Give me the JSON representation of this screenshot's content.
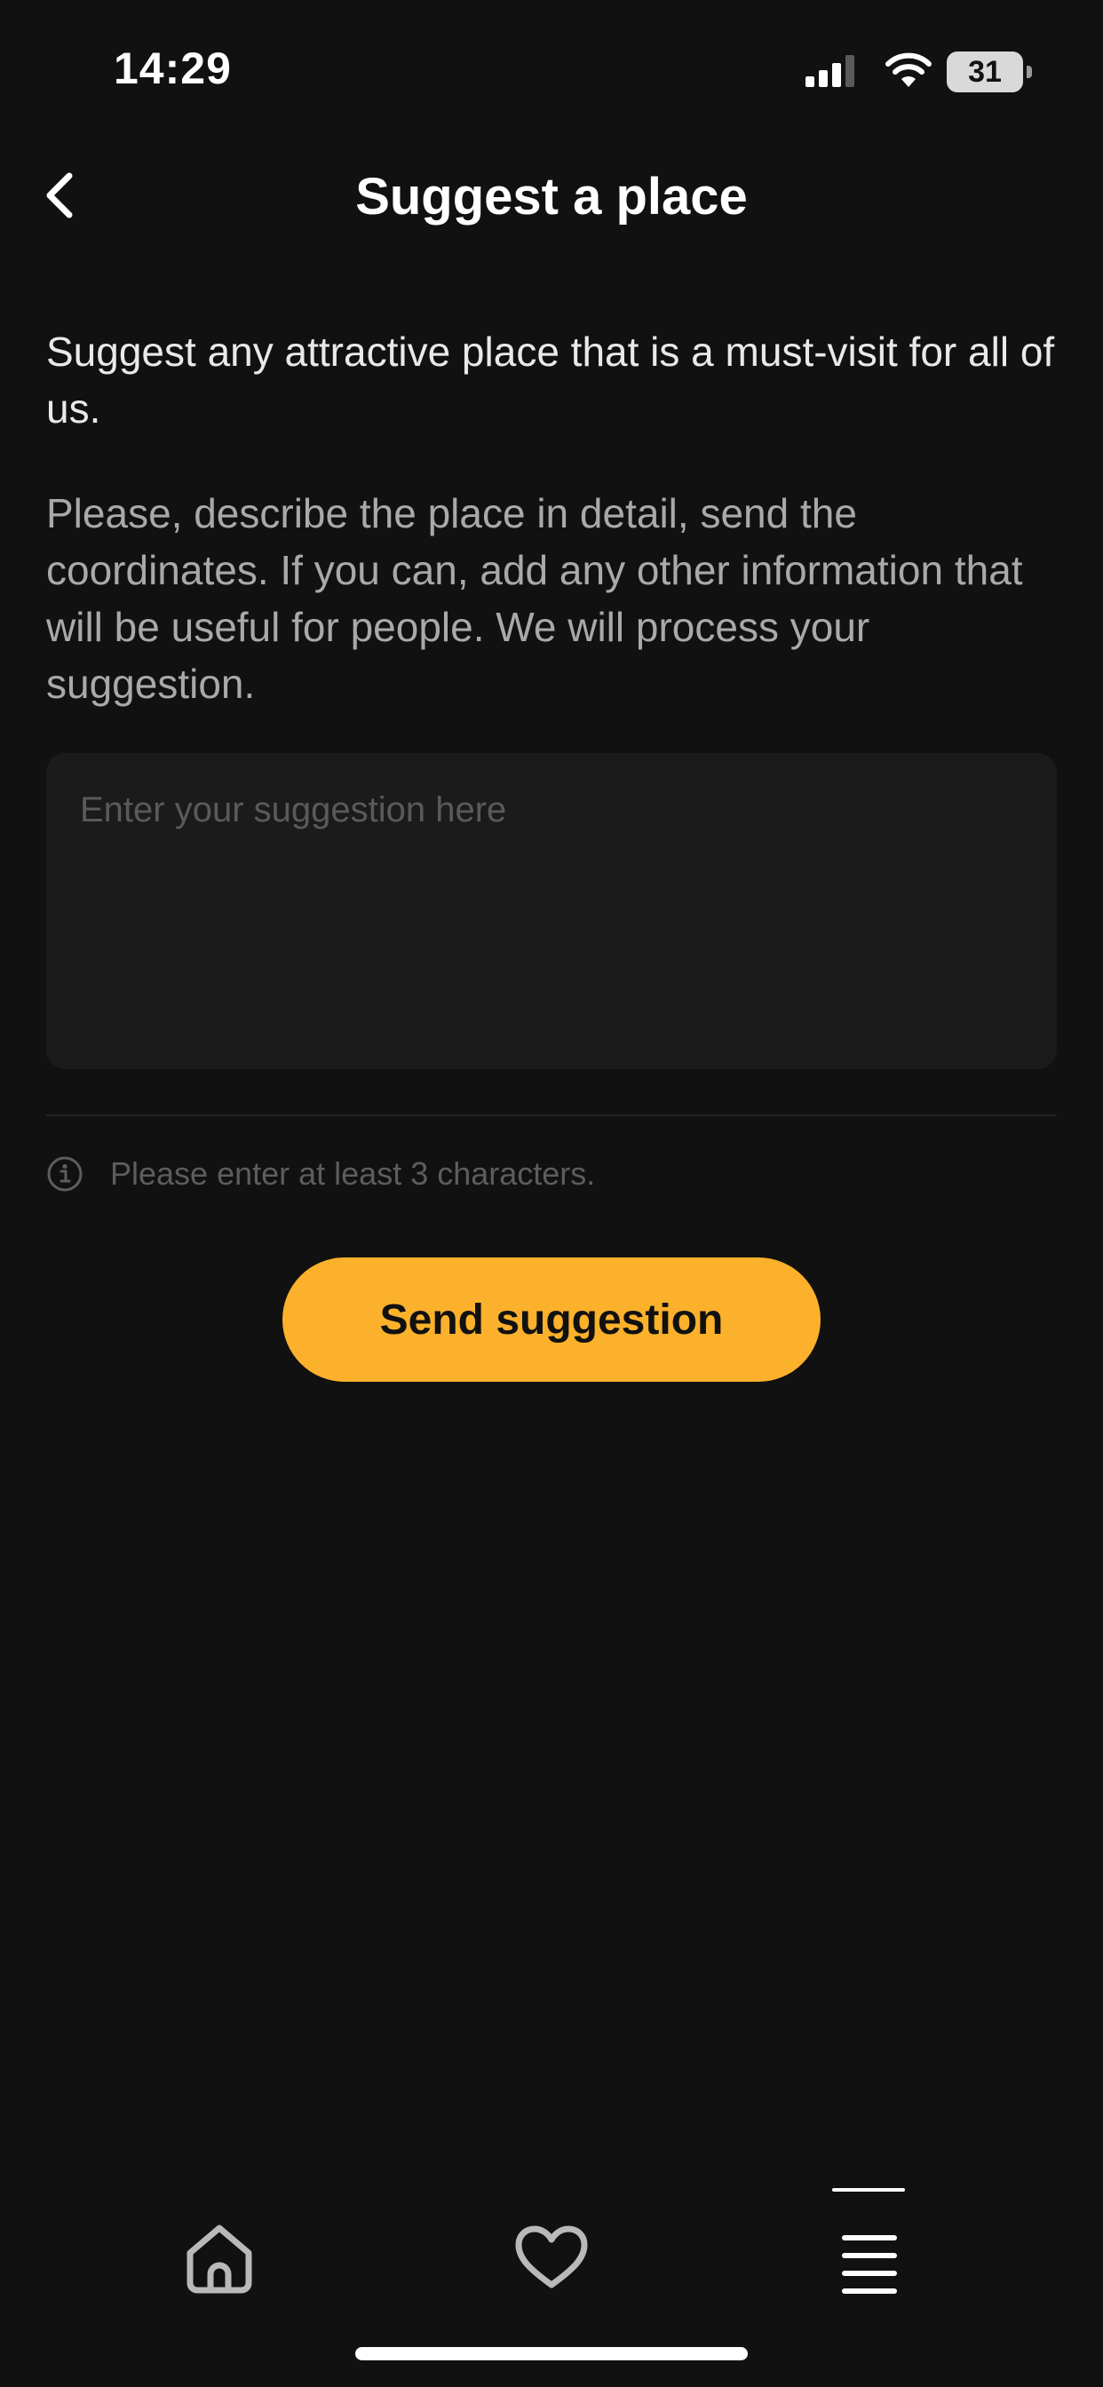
{
  "status_bar": {
    "time": "14:29",
    "battery_level": "31",
    "icons": [
      "signal-icon",
      "wifi-icon",
      "battery-icon"
    ]
  },
  "header": {
    "title": "Suggest a place",
    "back_icon": "chevron-left-icon"
  },
  "content": {
    "intro": "Suggest any attractive place that is a must-visit for all of us.",
    "detail": "Please, describe the place in detail, send the coordinates. If you can, add any other information that will be useful for people. We will process your suggestion.",
    "input": {
      "placeholder": "Enter your suggestion here",
      "value": ""
    },
    "hint": {
      "icon": "info-icon",
      "text": "Please enter at least 3 characters."
    },
    "send_button_label": "Send suggestion"
  },
  "bottom_nav": {
    "items": [
      {
        "icon": "home-icon",
        "active": false
      },
      {
        "icon": "heart-icon",
        "active": false
      },
      {
        "icon": "menu-icon",
        "active": true
      }
    ]
  },
  "colors": {
    "background": "#111111",
    "accent": "#fbb12b",
    "input_background": "#1b1b1b"
  }
}
